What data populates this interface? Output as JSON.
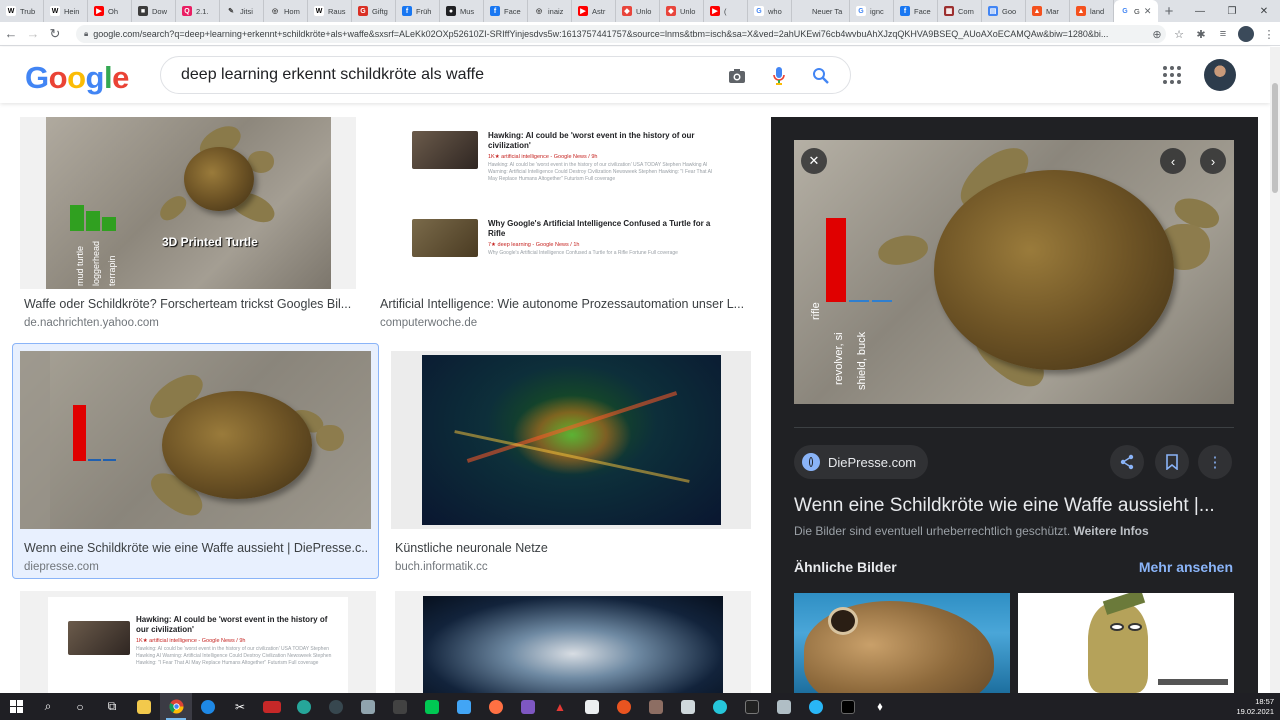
{
  "browser": {
    "tabs": [
      {
        "label": "Trub",
        "fav": "W",
        "color": "#ffffff",
        "fc": "#000"
      },
      {
        "label": "Hein",
        "fav": "W",
        "color": "#ffffff",
        "fc": "#000"
      },
      {
        "label": "Oh",
        "fav": "▶",
        "color": "#ff0000",
        "fc": "#fff"
      },
      {
        "label": "Dow",
        "fav": "■",
        "color": "#3c3c3c",
        "fc": "#fff"
      },
      {
        "label": "2.1.",
        "fav": "Q",
        "color": "#e91e63",
        "fc": "#fff"
      },
      {
        "label": "Jitsi",
        "fav": "✎",
        "color": "#dee1e6",
        "fc": "#444"
      },
      {
        "label": "Hom",
        "fav": "◎",
        "color": "#dee1e6",
        "fc": "#444"
      },
      {
        "label": "Raus",
        "fav": "W",
        "color": "#ffffff",
        "fc": "#000"
      },
      {
        "label": "Giftg",
        "fav": "G",
        "color": "#d93025",
        "fc": "#fff"
      },
      {
        "label": "Früh",
        "fav": "f",
        "color": "#1877f2",
        "fc": "#fff"
      },
      {
        "label": "Mus",
        "fav": "●",
        "color": "#202124",
        "fc": "#fff"
      },
      {
        "label": "Face",
        "fav": "f",
        "color": "#1877f2",
        "fc": "#fff"
      },
      {
        "label": "inaiz",
        "fav": "◎",
        "color": "#dee1e6",
        "fc": "#444"
      },
      {
        "label": "Astr",
        "fav": "▶",
        "color": "#ff0000",
        "fc": "#fff"
      },
      {
        "label": "Unlo",
        "fav": "◆",
        "color": "#e8453c",
        "fc": "#fff"
      },
      {
        "label": "Unlo",
        "fav": "◆",
        "color": "#e8453c",
        "fc": "#fff"
      },
      {
        "label": "(",
        "fav": "▶",
        "color": "#ff0000",
        "fc": "#fff"
      },
      {
        "label": "who",
        "fav": "G",
        "color": "#ffffff",
        "fc": "#4285f4"
      },
      {
        "label": "Neuer Ta",
        "fav": "",
        "color": "#dee1e6",
        "fc": "#444"
      },
      {
        "label": "ignc",
        "fav": "G",
        "color": "#ffffff",
        "fc": "#4285f4"
      },
      {
        "label": "Face",
        "fav": "f",
        "color": "#1877f2",
        "fc": "#fff"
      },
      {
        "label": "Com",
        "fav": "▦",
        "color": "#9c2f2f",
        "fc": "#fff"
      },
      {
        "label": "Goo",
        "fav": "▤",
        "color": "#4285f4",
        "fc": "#fff"
      },
      {
        "label": "Mar",
        "fav": "▲",
        "color": "#f4511e",
        "fc": "#fff"
      },
      {
        "label": "land",
        "fav": "▲",
        "color": "#f4511e",
        "fc": "#fff"
      },
      {
        "label": "G",
        "fav": "G",
        "color": "#ffffff",
        "fc": "#4285f4",
        "active": true
      }
    ],
    "new_tab": "+",
    "url": "google.com/search?q=deep+learning+erkennt+schildkröte+als+waffe&sxsrf=ALeKk02OXp52610ZI-SRIffYinjesdvs5w:1613757441757&source=lnms&tbm=isch&sa=X&ved=2ahUKEwi76cb4wvbuAhXJzqQKHVA9BSEQ_AUoAXoECAMQAw&biw=1280&bi..."
  },
  "search": {
    "logo": [
      "G",
      "o",
      "o",
      "g",
      "l",
      "e"
    ],
    "query": "deep learning erkennt schildkröte als waffe"
  },
  "results": [
    {
      "title": "Waffe oder Schildkröte? Forscherteam trickst Googles Bil...",
      "source": "de.nachrichten.yahoo.com"
    },
    {
      "title": "Artificial Intelligence: Wie autonome Prozessautomation unser L...",
      "source": "computerwoche.de"
    },
    {
      "title": "Wenn eine Schildkröte wie eine Waffe aussieht | DiePresse.c...",
      "source": "diepresse.com"
    },
    {
      "title": "Künstliche neuronale Netze",
      "source": "buch.informatik.cc"
    }
  ],
  "thumb_labels": {
    "turtle_caption": "3D Printed Turtle",
    "turtle_bars": [
      "mud turtle",
      "loggerhead",
      "terrapin"
    ],
    "preview_bars": [
      "rifle",
      "revolver, si",
      "shield, buck"
    ],
    "news1_head": "Hawking: AI could be 'worst event in the history of our civilization'",
    "news1_meta": "1K★ artificial intelligence - Google News / 9h",
    "news1_text": "Hawking: AI could be 'worst event in the history of our civilization' USA TODAY Stephen Hawking AI Warning: Artificial Intelligence Could Destroy Civilization Newsweek Stephen Hawking: \"I Fear That AI May Replace Humans Altogether\" Futurism Full coverage",
    "news2_head": "Why Google's Artificial Intelligence Confused a Turtle for a Rifle",
    "news2_meta": "7★ deep learning - Google News / 1h",
    "news2_text": "Why Google's Artificial Intelligence Confused a Turtle for a Rifle Fortune Full coverage"
  },
  "preview": {
    "source_chip": "DiePresse.com",
    "title": "Wenn eine Schildkröte wie eine Waffe aussieht |...",
    "copyright": "Die Bilder sind eventuell urheberrechtlich geschützt.",
    "more_info": "Weitere Infos",
    "similar_heading": "Ähnliche Bilder",
    "see_more": "Mehr ansehen"
  },
  "taskbar": {
    "time": "18:57",
    "date": "19.02.2021"
  }
}
